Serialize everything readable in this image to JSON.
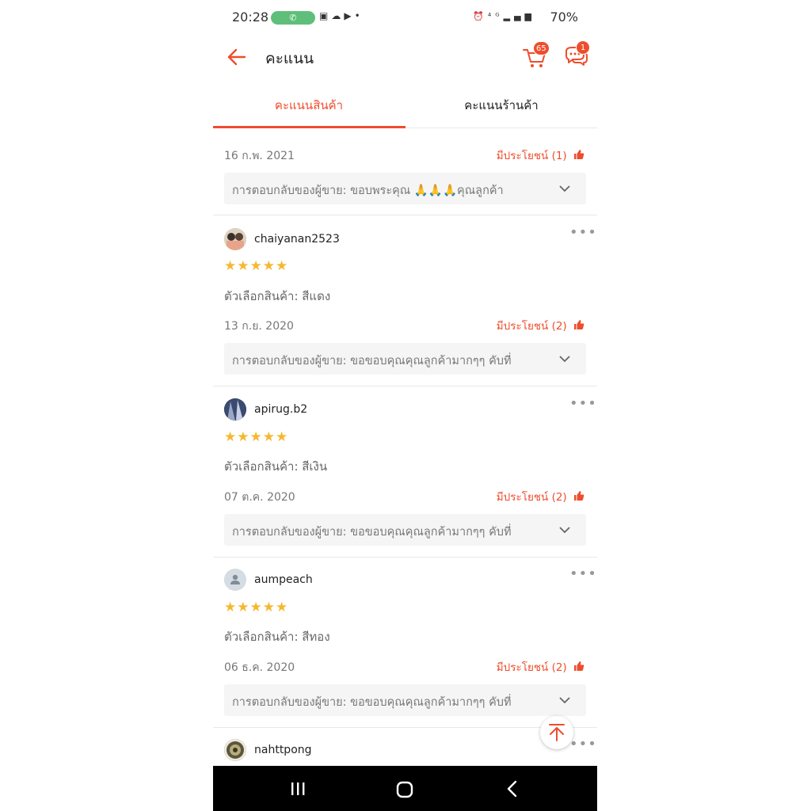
{
  "status_bar": {
    "time": "20:28",
    "call_icon": "phone-icon",
    "left_icons": "image-icon cloud-icon youtube-icon dot",
    "right_icons": "alarm-icon 4G signal-icon",
    "battery": "70%"
  },
  "header": {
    "title": "คะแนน",
    "cart_badge": "65",
    "chat_badge": "1"
  },
  "tabs": [
    {
      "label": "คะแนนสินค้า",
      "active": true
    },
    {
      "label": "คะแนนร้านค้า",
      "active": false
    }
  ],
  "reviews": [
    {
      "date": "16 ก.พ. 2021",
      "helpful": "มีประโยชน์ (1)",
      "reply": "การตอบกลับของผู้ขาย: ขอบพระคุณ 🙏🙏🙏คุณลูกค้า"
    },
    {
      "username": "chaiyanan2523",
      "stars": "★★★★★",
      "variant": "ตัวเลือกสินค้า: สีแดง",
      "date": "13 ก.ย. 2020",
      "helpful": "มีประโยชน์ (2)",
      "reply": "การตอบกลับของผู้ขาย: ขอขอบคุณคุณลูกค้ามากๆๆ คับที่"
    },
    {
      "username": "apirug.b2",
      "stars": "★★★★★",
      "variant": "ตัวเลือกสินค้า: สีเงิน",
      "date": "07 ต.ค. 2020",
      "helpful": "มีประโยชน์ (2)",
      "reply": "การตอบกลับของผู้ขาย: ขอขอบคุณคุณลูกค้ามากๆๆ คับที่"
    },
    {
      "username": "aumpeach",
      "stars": "★★★★★",
      "variant": "ตัวเลือกสินค้า: สีทอง",
      "date": "06 ธ.ค. 2020",
      "helpful": "มีประโยชน์ (2)",
      "reply": "การตอบกลับของผู้ขาย: ขอขอบคุณคุณลูกค้ามากๆๆ คับที่"
    },
    {
      "username": "nahttpong"
    }
  ],
  "colors": {
    "accent": "#ee4d2d",
    "star": "#f5b82e"
  }
}
